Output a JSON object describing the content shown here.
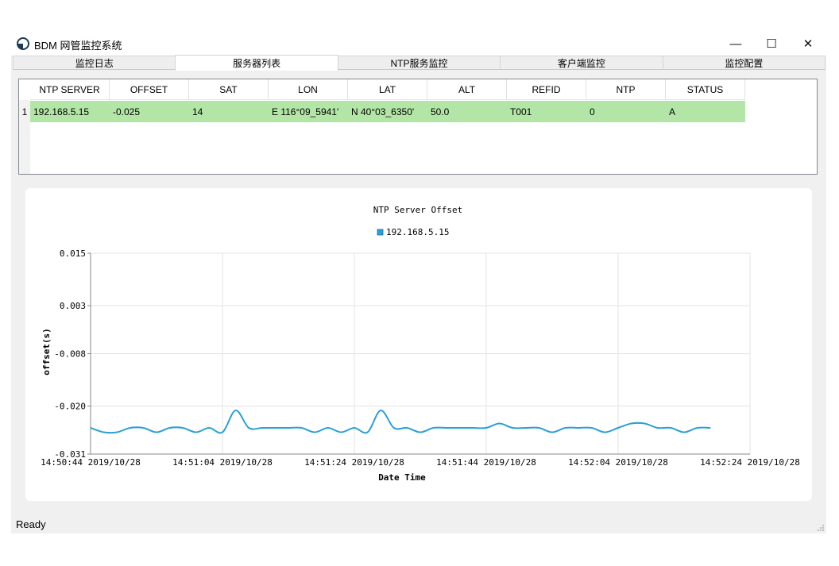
{
  "window": {
    "title": "BDM 网管监控系统",
    "minimize": "—",
    "maximize": "☐",
    "close": "✕"
  },
  "tabs": [
    {
      "label": "监控日志",
      "active": false
    },
    {
      "label": "服务器列表",
      "active": true
    },
    {
      "label": "NTP服务监控",
      "active": false
    },
    {
      "label": "客户端监控",
      "active": false
    },
    {
      "label": "监控配置",
      "active": false
    }
  ],
  "table": {
    "columns": [
      "NTP SERVER",
      "OFFSET",
      "SAT",
      "LON",
      "LAT",
      "ALT",
      "REFID",
      "NTP",
      "STATUS"
    ],
    "rows": [
      {
        "index": "1",
        "cells": [
          "192.168.5.15",
          "-0.025",
          "14",
          "E 116°09_5941'",
          "N 40°03_6350'",
          "50.0",
          "T001",
          "0",
          "A"
        ]
      }
    ],
    "row_highlight": "#b3e6a6"
  },
  "chart_data": {
    "type": "line",
    "title": "NTP Server Offset",
    "xlabel": "Date Time",
    "ylabel": "offset(s)",
    "series": [
      {
        "name": "192.168.5.15",
        "color": "#2b9fd8",
        "x": [
          "14:50:44",
          "14:50:46",
          "14:50:48",
          "14:50:50",
          "14:50:52",
          "14:50:54",
          "14:50:56",
          "14:50:58",
          "14:51:00",
          "14:51:02",
          "14:51:04",
          "14:51:06",
          "14:51:08",
          "14:51:10",
          "14:51:12",
          "14:51:14",
          "14:51:16",
          "14:51:18",
          "14:51:20",
          "14:51:22",
          "14:51:24",
          "14:51:26",
          "14:51:28",
          "14:51:30",
          "14:51:32",
          "14:51:34",
          "14:51:36",
          "14:51:38",
          "14:51:40",
          "14:51:42",
          "14:51:44",
          "14:51:46",
          "14:51:48",
          "14:51:50",
          "14:51:52",
          "14:51:54",
          "14:51:56",
          "14:51:58",
          "14:52:00",
          "14:52:02",
          "14:52:04",
          "14:52:06",
          "14:52:08",
          "14:52:10",
          "14:52:12",
          "14:52:14",
          "14:52:16",
          "14:52:18"
        ],
        "values": [
          -0.025,
          -0.026,
          -0.026,
          -0.025,
          -0.025,
          -0.026,
          -0.025,
          -0.025,
          -0.026,
          -0.025,
          -0.026,
          -0.021,
          -0.025,
          -0.025,
          -0.025,
          -0.025,
          -0.025,
          -0.026,
          -0.025,
          -0.026,
          -0.025,
          -0.026,
          -0.021,
          -0.025,
          -0.025,
          -0.026,
          -0.025,
          -0.025,
          -0.025,
          -0.025,
          -0.025,
          -0.024,
          -0.025,
          -0.025,
          -0.025,
          -0.026,
          -0.025,
          -0.025,
          -0.025,
          -0.026,
          -0.025,
          -0.024,
          -0.024,
          -0.025,
          -0.025,
          -0.026,
          -0.025,
          -0.025
        ]
      }
    ],
    "x_ticks": [
      "14:50:44 2019/10/28",
      "14:51:04 2019/10/28",
      "14:51:24 2019/10/28",
      "14:51:44 2019/10/28",
      "14:52:04 2019/10/28",
      "14:52:24 2019/10/28"
    ],
    "y_ticks": [
      "0.015",
      "0.003",
      "-0.008",
      "-0.020",
      "-0.031"
    ],
    "ylim": [
      -0.031,
      0.015
    ],
    "grid": true,
    "legend": "top-center"
  },
  "status": {
    "text": "Ready"
  }
}
